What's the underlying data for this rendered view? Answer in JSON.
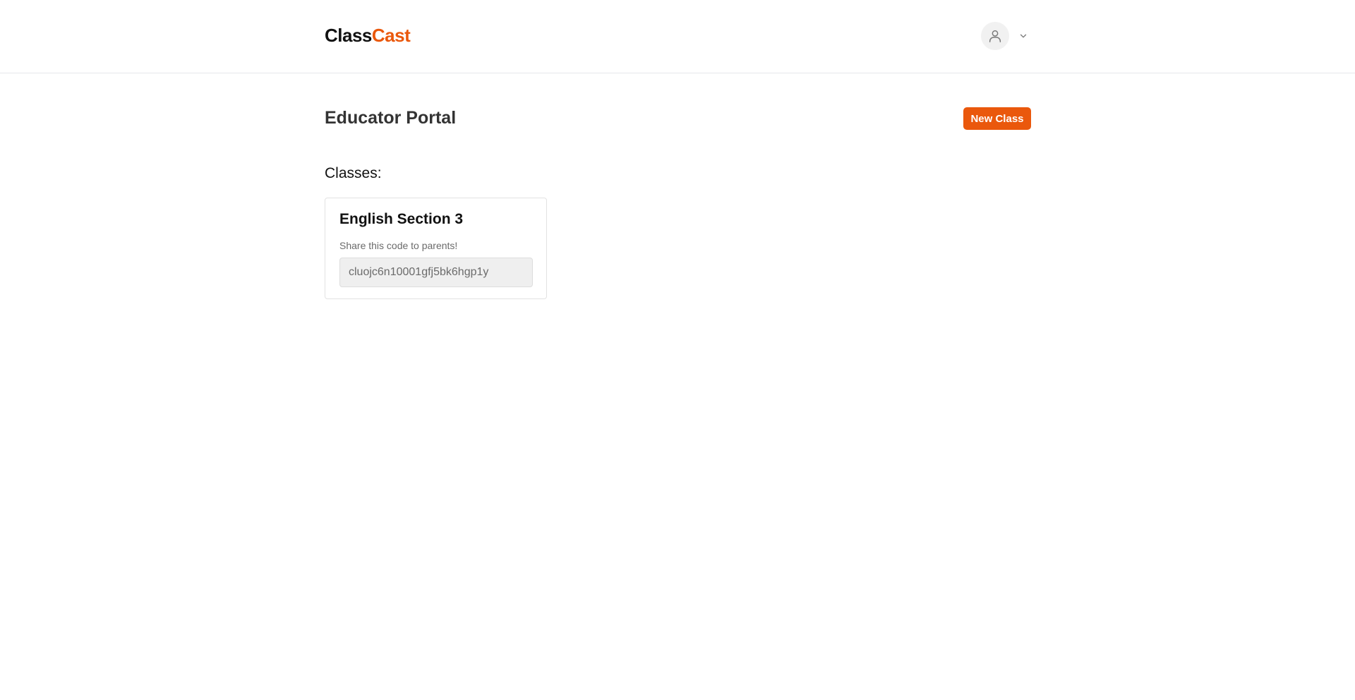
{
  "header": {
    "logo_part1": "Class",
    "logo_part2": "Cast",
    "user_menu": {
      "avatar_icon": "user-icon",
      "chevron_icon": "chevron-down-icon"
    }
  },
  "main": {
    "title": "Educator Portal",
    "new_class_label": "New Class",
    "classes_label": "Classes:",
    "classes": [
      {
        "name": "English Section 3",
        "hint": "Share this code to parents!",
        "code": "cluojc6n10001gfj5bk6hgp1y"
      }
    ]
  },
  "colors": {
    "accent": "#ea580c",
    "text": "#111111",
    "muted": "#6b6b6b",
    "border": "#e5e7eb"
  }
}
